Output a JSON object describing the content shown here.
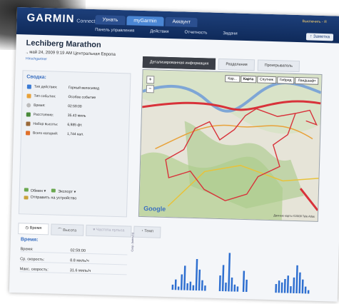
{
  "header": {
    "logo": "GARMIN",
    "logo_sub": "Connect",
    "top_tabs": [
      "Узнать",
      "myGarmin",
      "Аккаунт"
    ],
    "user_link": "Выключить - Я",
    "sub_tabs": [
      "Панель управления",
      "Действия",
      "Отчетность",
      "Задачи"
    ],
    "add_button": "Заметка"
  },
  "activity": {
    "title": "Lechiberg Marathon",
    "date": "., май 24, 2009 9:19 AM Центральная Европа",
    "owner": "Hirschgartner"
  },
  "summary": {
    "heading": "Сводка:",
    "rows": [
      {
        "label": "Тип действия:",
        "value": "Горный велосипед"
      },
      {
        "label": "Тип события:",
        "value": "Особое событие"
      },
      {
        "label": "Время:",
        "value": "02:59:00"
      },
      {
        "label": "Расстояние:",
        "value": "35.43 миль"
      },
      {
        "label": "Набор высоты:",
        "value": "6,985 фт."
      },
      {
        "label": "Всего калорий:",
        "value": "1,744 кал."
      }
    ],
    "share": "Обмен",
    "export": "Экспорт",
    "send": "Отправить на устройство"
  },
  "view_tabs": [
    "Детализированная информация",
    "Разделения",
    "Проигрыватель"
  ],
  "map": {
    "types": [
      "Карта",
      "Спутник",
      "Гибрид",
      "Ландшафт"
    ],
    "map_label": "Кар...",
    "google": "Google",
    "copyright": "Данные карты ©2009 Tele Atlas"
  },
  "bottom_tabs": [
    "Время",
    "Высота",
    "Частота пульса",
    "Темп"
  ],
  "time_section": {
    "heading": "Время:",
    "rows": [
      {
        "label": "Время:",
        "value": "02:59:00"
      },
      {
        "label": "Ср. скорость:",
        "value": "8.8 миль/ч"
      },
      {
        "label": "Макс. скорость:",
        "value": "31.6 миль/ч"
      }
    ]
  },
  "colors": {
    "header": "#1d3f7a",
    "accent": "#3a6fc0",
    "route": "#d8323a",
    "chart": "#2e6fd0"
  },
  "chart_data": {
    "type": "bar",
    "ylabel": "Скор. (миль/ч)",
    "values": [
      0,
      0,
      0,
      0,
      0,
      0,
      0,
      0,
      0,
      0,
      0,
      3,
      6,
      2,
      9,
      14,
      4,
      5,
      3,
      18,
      12,
      6,
      3,
      0,
      0,
      0,
      0,
      9,
      15,
      5,
      22,
      8,
      4,
      3,
      0,
      12,
      7,
      0,
      0,
      0,
      0,
      0,
      0,
      0,
      0,
      0,
      5,
      7,
      6,
      8,
      10,
      4,
      9,
      16,
      12,
      8,
      4,
      2
    ]
  }
}
